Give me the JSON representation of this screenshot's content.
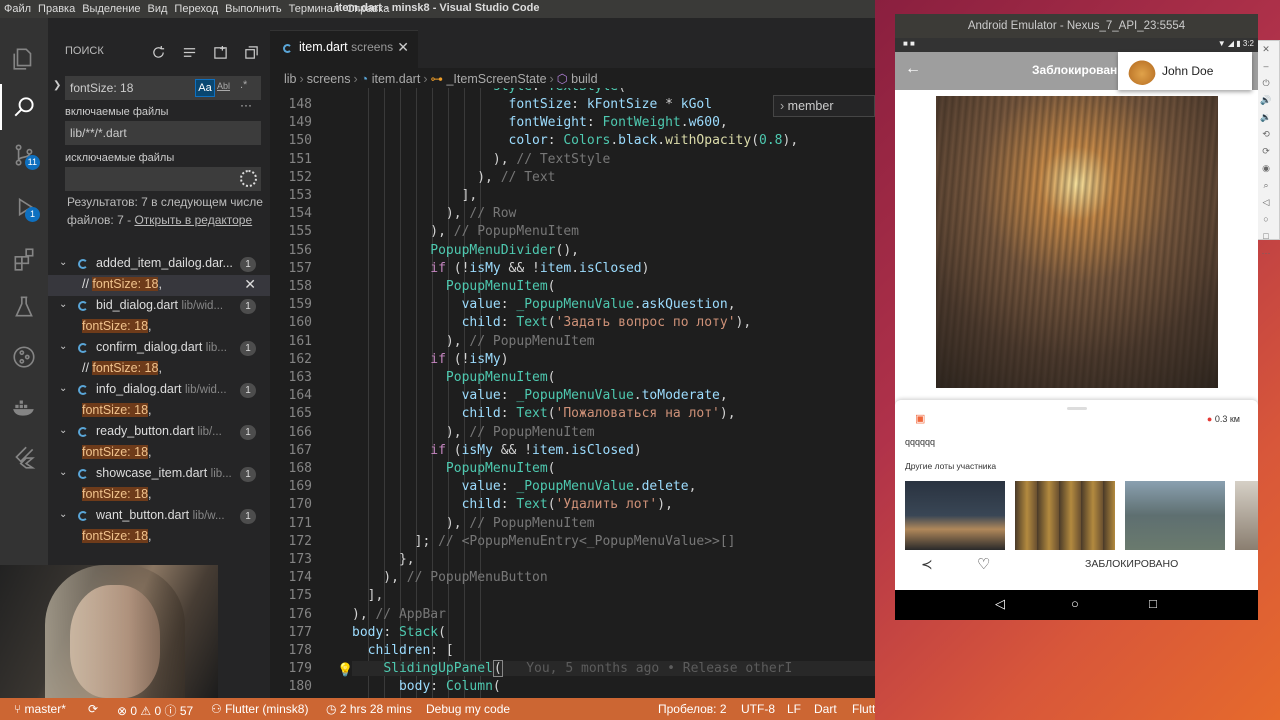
{
  "window_title": "item.dart - minsk8 - Visual Studio Code",
  "menu": [
    "Файл",
    "Правка",
    "Выделение",
    "Вид",
    "Переход",
    "Выполнить",
    "Терминал",
    "Справка"
  ],
  "activity": {
    "scm_badge": "11",
    "debug_badge": "1"
  },
  "search": {
    "title": "ПОИСК",
    "query": "fontSize: 18",
    "match_case": "Aa",
    "whole_word": "Abl",
    "include_label": "включаемые файлы",
    "include_value": "lib/**/*.dart",
    "exclude_label": "исключаемые файлы",
    "exclude_value": "",
    "result_text": "Результатов: 7 в следующем числе файлов: 7 - ",
    "open_in_editor": "Открыть в редакторе",
    "files": [
      {
        "name": "added_item_dailog.dar...",
        "path": "",
        "count": "1",
        "prefix": "// ",
        "match": "fontSize: 18",
        "suffix": ","
      },
      {
        "name": "bid_dialog.dart",
        "path": "lib/wid...",
        "count": "1",
        "prefix": "",
        "match": "fontSize: 18",
        "suffix": ","
      },
      {
        "name": "confirm_dialog.dart",
        "path": "lib...",
        "count": "1",
        "prefix": "// ",
        "match": "fontSize: 18",
        "suffix": ","
      },
      {
        "name": "info_dialog.dart",
        "path": "lib/wid...",
        "count": "1",
        "prefix": "",
        "match": "fontSize: 18",
        "suffix": ","
      },
      {
        "name": "ready_button.dart",
        "path": "lib/...",
        "count": "1",
        "prefix": "",
        "match": "fontSize: 18",
        "suffix": ","
      },
      {
        "name": "showcase_item.dart",
        "path": "lib...",
        "count": "1",
        "prefix": "",
        "match": "fontSize: 18",
        "suffix": ","
      },
      {
        "name": "want_button.dart",
        "path": "lib/w...",
        "count": "1",
        "prefix": "",
        "match": "fontSize: 18",
        "suffix": ","
      }
    ]
  },
  "tab": {
    "name": "item.dart",
    "path": "screens"
  },
  "breadcrumbs": [
    "lib",
    "screens",
    "item.dart",
    "_ItemScreenState",
    "build"
  ],
  "hover_text": "member",
  "code": {
    "line_numbers": [
      "148",
      "149",
      "150",
      "151",
      "152",
      "153",
      "154",
      "155",
      "156",
      "157",
      "158",
      "159",
      "160",
      "161",
      "162",
      "163",
      "164",
      "165",
      "166",
      "167",
      "168",
      "169",
      "170",
      "171",
      "172",
      "173",
      "174",
      "175",
      "176",
      "177",
      "178",
      "179",
      "180"
    ],
    "blame": "You, 5 months ago • Release otherI"
  },
  "status": {
    "branch": "master*",
    "problems": "⊗ 0 ⚠ 0 ⓘ 57",
    "flutter": "Flutter (minsk8)",
    "time": "2 hrs 28 mins",
    "debug": "Debug my code",
    "spaces": "Пробелов: 2",
    "encoding": "UTF-8",
    "eol": "LF",
    "lang": "Dart",
    "flutter_right": "Flutt"
  },
  "emulator": {
    "title": "Android Emulator - Nexus_7_API_23:5554",
    "clock": "3:2",
    "appbar_title": "Заблокирован",
    "user": "John Doe",
    "distance": "0.3 км",
    "description": "qqqqqq",
    "other_lots": "Другие лоты участника",
    "blocked_label": "ЗАБЛОКИРОВАНО"
  }
}
